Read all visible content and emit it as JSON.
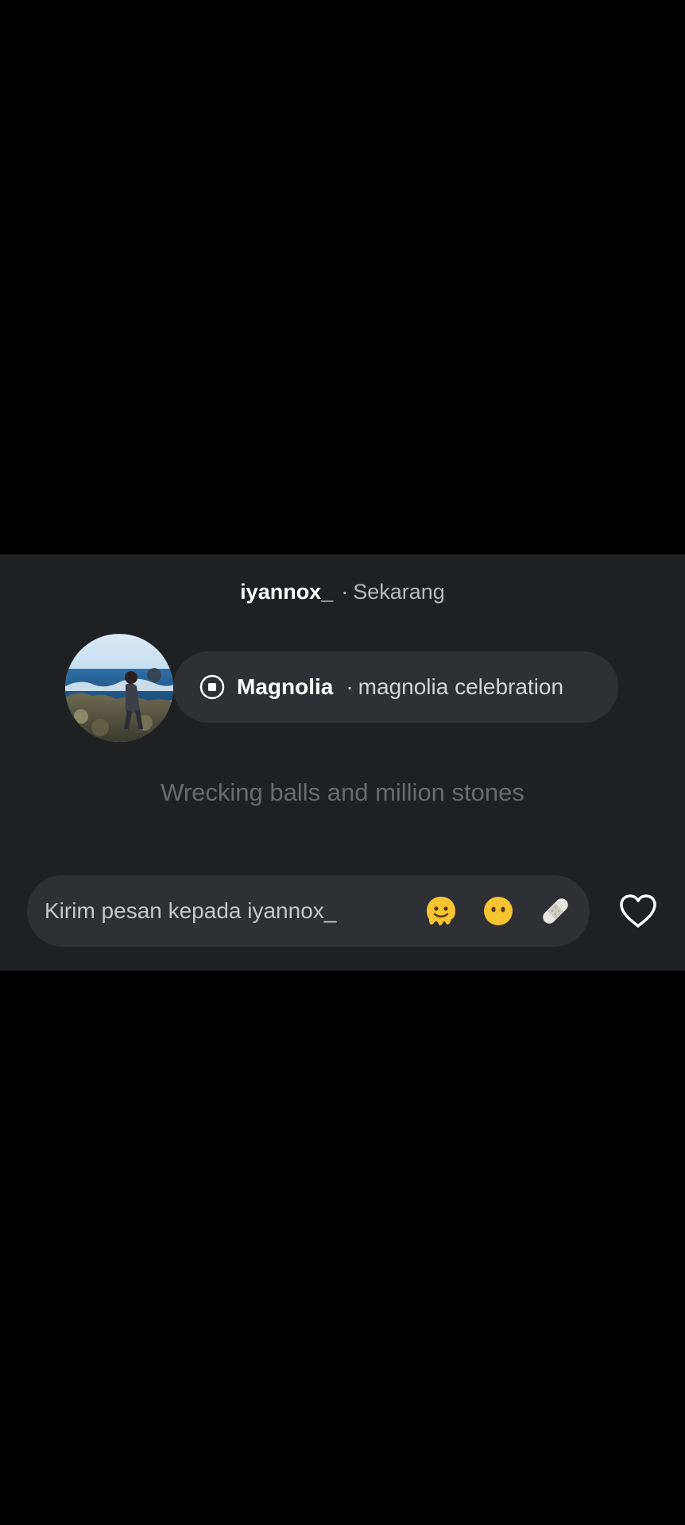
{
  "story_reply": {
    "username": "iyannox_",
    "separator": "·",
    "timestamp": "Sekarang"
  },
  "note": {
    "icon": "stop-icon",
    "song_title": "Magnolia",
    "separator": "·",
    "artist": "magnolia celebration"
  },
  "lyric": "Wrecking balls and million stones",
  "message": {
    "placeholder": "Kirim pesan kepada iyannox_",
    "quick_reactions": [
      "melting-face-emoji",
      "face-without-mouth-emoji",
      "bandage-emoji"
    ],
    "like_icon": "heart-icon"
  },
  "colors": {
    "background": "#000000",
    "card": "#1f2022",
    "pill": "#2e3034",
    "muted_text": "#6a6b70"
  }
}
